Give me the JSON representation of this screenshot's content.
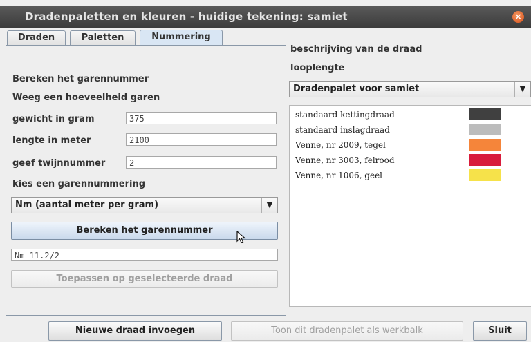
{
  "window": {
    "title": "Dradenpaletten en kleuren - huidige tekening: samiet"
  },
  "tabs": [
    {
      "label": "Draden"
    },
    {
      "label": "Paletten"
    },
    {
      "label": "Nummering"
    }
  ],
  "form": {
    "heading1": "Bereken het garennummer",
    "heading2": "Weeg een hoeveelheid garen",
    "weight_label": "gewicht in gram",
    "weight_value": "375",
    "length_label": "lengte in meter",
    "length_value": "2100",
    "twist_label": "geef twijnnummer",
    "twist_value": "2",
    "numbering_label": "kies een garennummering",
    "numbering_selected": "Nm (aantal meter per gram)",
    "calc_button": "Bereken het garennummer",
    "result_value": "Nm 11.2/2",
    "apply_button": "Toepassen op geselecteerde draad"
  },
  "right": {
    "desc_label": "beschrijving van de draad",
    "length_label": "looplengte",
    "palette_selected": "Dradenpalet voor samiet",
    "threads": [
      {
        "name": "standaard kettingdraad",
        "color": "#404040"
      },
      {
        "name": "standaard inslagdraad",
        "color": "#bcbcbc"
      },
      {
        "name": "Venne, nr 2009, tegel",
        "color": "#f5853a"
      },
      {
        "name": "Venne, nr 3003, felrood",
        "color": "#d81c3c"
      },
      {
        "name": "Venne, nr 1006, geel",
        "color": "#f6e24a"
      }
    ]
  },
  "footer": {
    "insert_button": "Nieuwe draad invoegen",
    "toolbar_button": "Toon dit dradenpalet als werkbalk",
    "close_button": "Sluit"
  }
}
